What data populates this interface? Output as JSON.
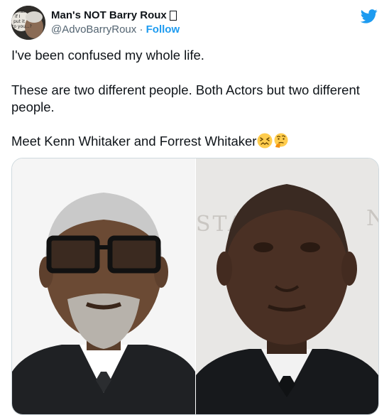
{
  "tweet": {
    "display_name": "Man's NOT Barry Roux",
    "handle": "@AdvoBarryRoux",
    "separator": "·",
    "follow_label": "Follow",
    "paragraphs": [
      "I've been confused my whole life.",
      "These are two different people. Both Actors but two different people.",
      "Meet Kenn Whitaker and Forrest Whitaker"
    ],
    "avatar_text": [
      "What",
      "if I",
      "put it",
      "to you...?"
    ],
    "media_backdrop_text": "STA",
    "media_backdrop_text_right": "N"
  },
  "icons": {
    "brand": "twitter-bird-icon",
    "emoji_1": "confounded-face-emoji",
    "emoji_2": "thinking-face-emoji"
  },
  "colors": {
    "accent": "#1d9bf0",
    "text": "#0f1419",
    "secondary_text": "#536471",
    "border": "#cfd9de"
  }
}
